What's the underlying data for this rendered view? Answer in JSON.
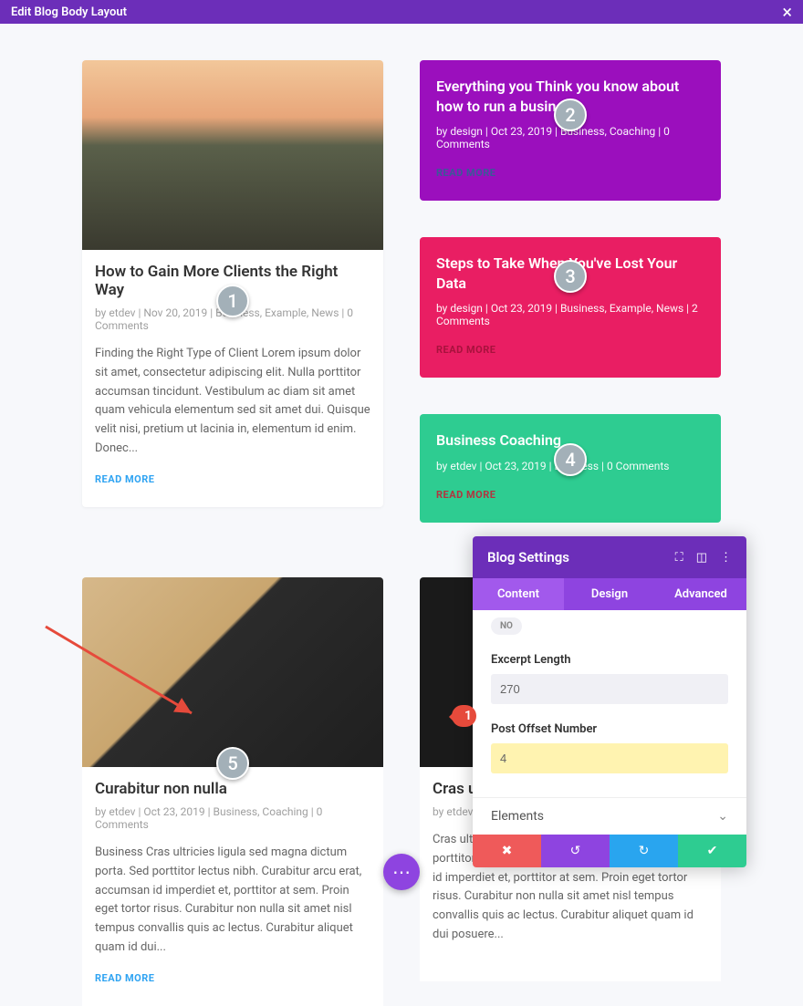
{
  "topbar": {
    "title": "Edit Blog Body Layout"
  },
  "badges": [
    "1",
    "2",
    "3",
    "4",
    "5"
  ],
  "main_post": {
    "title": "How to Gain More Clients the Right Way",
    "meta": "by etdev | Nov 20, 2019 | Business, Example, News | 0 Comments",
    "excerpt": "Finding the Right Type of Client Lorem ipsum dolor sit amet, consectetur adipiscing elit. Nulla porttitor accumsan tincidunt. Vestibulum ac diam sit amet quam vehicula elementum sed sit amet dui. Quisque velit nisi, pretium ut lacinia in, elementum id enim. Donec...",
    "read": "READ MORE"
  },
  "side_posts": [
    {
      "title": "Everything you Think you know about how to run a business",
      "meta": "by design | Oct 23, 2019 | Business, Coaching | 0 Comments",
      "read": "READ MORE"
    },
    {
      "title": "Steps to Take When You've Lost Your Data",
      "meta": "by design | Oct 23, 2019 | Business, Example, News | 2 Comments",
      "read": "READ MORE"
    },
    {
      "title": "Business Coaching",
      "meta": "by etdev | Oct 23, 2019 | Business | 0 Comments",
      "read": "READ MORE"
    }
  ],
  "bottom_left": {
    "title": "Curabitur non nulla",
    "meta": "by etdev | Oct 23, 2019 | Business, Coaching | 0 Comments",
    "excerpt": "Business Cras ultricies ligula sed magna dictum porta. Sed porttitor lectus nibh. Curabitur arcu erat, accumsan id imperdiet et, porttitor at sem. Proin eget tortor risus. Curabitur non nulla sit amet nisl tempus convallis quis ac lectus. Curabitur aliquet quam id dui...",
    "read": "READ MORE"
  },
  "bottom_right": {
    "title": "Cras ult",
    "meta": "by etdev",
    "excerpt": "Cras ultricies ligula sed magna dictum porta. Sed porttitor lectus nibh. Curabitur arcu erat, accumsan id imperdiet et, porttitor at sem. Proin eget tortor risus. Curabitur non nulla sit amet nisl tempus convallis quis ac lectus. Curabitur aliquet quam id dui posuere..."
  },
  "panel": {
    "title": "Blog Settings",
    "tabs": {
      "content": "Content",
      "design": "Design",
      "advanced": "Advanced"
    },
    "no_label": "NO",
    "excerpt_label": "Excerpt Length",
    "excerpt_value": "270",
    "offset_label": "Post Offset Number",
    "offset_value": "4",
    "elements_label": "Elements"
  },
  "callout1": "1"
}
